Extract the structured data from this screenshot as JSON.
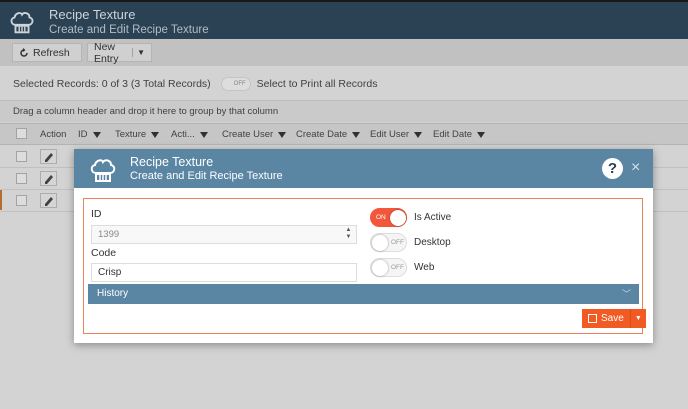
{
  "app": {
    "title": "Recipe Texture",
    "subtitle": "Create and Edit Recipe Texture",
    "toolbar": {
      "refresh_label": "Refresh",
      "new_entry_label": "New Entry"
    },
    "selection": {
      "records_text": "Selected Records: 0 of 3 (3 Total Records)",
      "toggle_state": "OFF",
      "print_label": "Select to Print all Records"
    },
    "group_hint": "Drag a column header and drop it here to group by that column",
    "columns": [
      "Action",
      "ID",
      "Texture",
      "Acti...",
      "Create User",
      "Create Date",
      "Edit User",
      "Edit Date"
    ],
    "row_count": 3
  },
  "modal": {
    "title": "Recipe Texture",
    "subtitle": "Create and Edit Recipe Texture",
    "help_symbol": "?",
    "close_symbol": "×",
    "id_label": "ID",
    "id_value": "1399",
    "code_label": "Code",
    "code_value": "Crisp",
    "toggles": [
      {
        "label": "Is Active",
        "state": "ON"
      },
      {
        "label": "Desktop",
        "state": "OFF"
      },
      {
        "label": "Web",
        "state": "OFF"
      }
    ],
    "history_label": "History",
    "save_label": "Save"
  },
  "colors": {
    "header": "#2c4558",
    "modal_header": "#5a85a3",
    "accent": "#f15a22",
    "toggle_on": "#f2573c"
  },
  "icons": {
    "logo": "chef-hat-icon",
    "refresh": "refresh-icon",
    "filter": "filter-icon",
    "edit": "pencil-icon",
    "save": "floppy-disk-icon",
    "chevron": "chevron-down-icon"
  }
}
